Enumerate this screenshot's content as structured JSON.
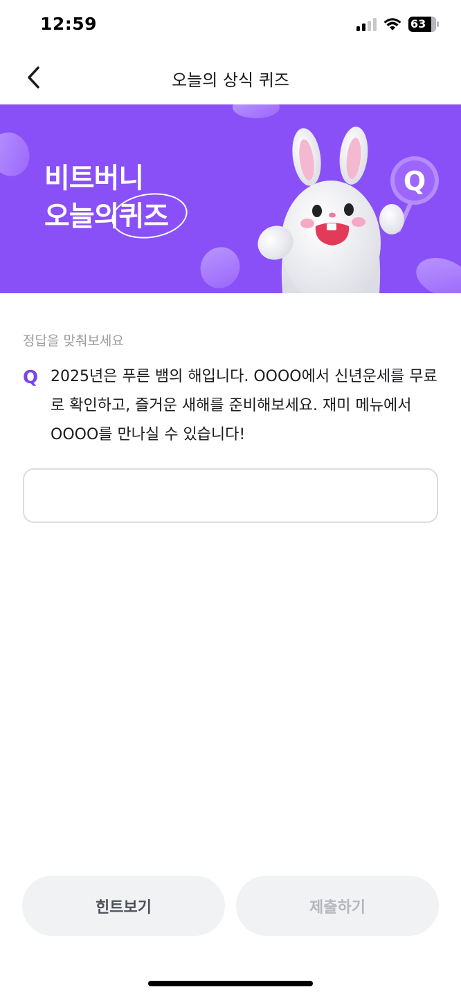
{
  "status_bar": {
    "time": "12:59",
    "battery_label": "63",
    "icons": [
      "signal-icon",
      "wifi-icon",
      "battery-icon"
    ]
  },
  "nav": {
    "title": "오늘의 상식 퀴즈",
    "back_icon": "chevron-left-icon"
  },
  "banner": {
    "line1": "비트버니",
    "line2_prefix": "오늘의",
    "line2_circled": "퀴즈",
    "background_color": "#8a50f8",
    "mascot": "bunny-mascot-illustration",
    "badge_letter": "Q"
  },
  "quiz": {
    "instruction": "정답을 맞춰보세요",
    "q_mark": "Q",
    "question": "2025년은 푸른 뱀의 해입니다. OOOO에서 신년운세를 무료로 확인하고, 즐거운 새해를 준비해보세요. 재미 메뉴에서 OOOO를 만나실 수 있습니다!",
    "answer_value": "",
    "accent_color": "#7a45e6"
  },
  "actions": {
    "hint_label": "힌트보기",
    "submit_label": "제출하기"
  }
}
